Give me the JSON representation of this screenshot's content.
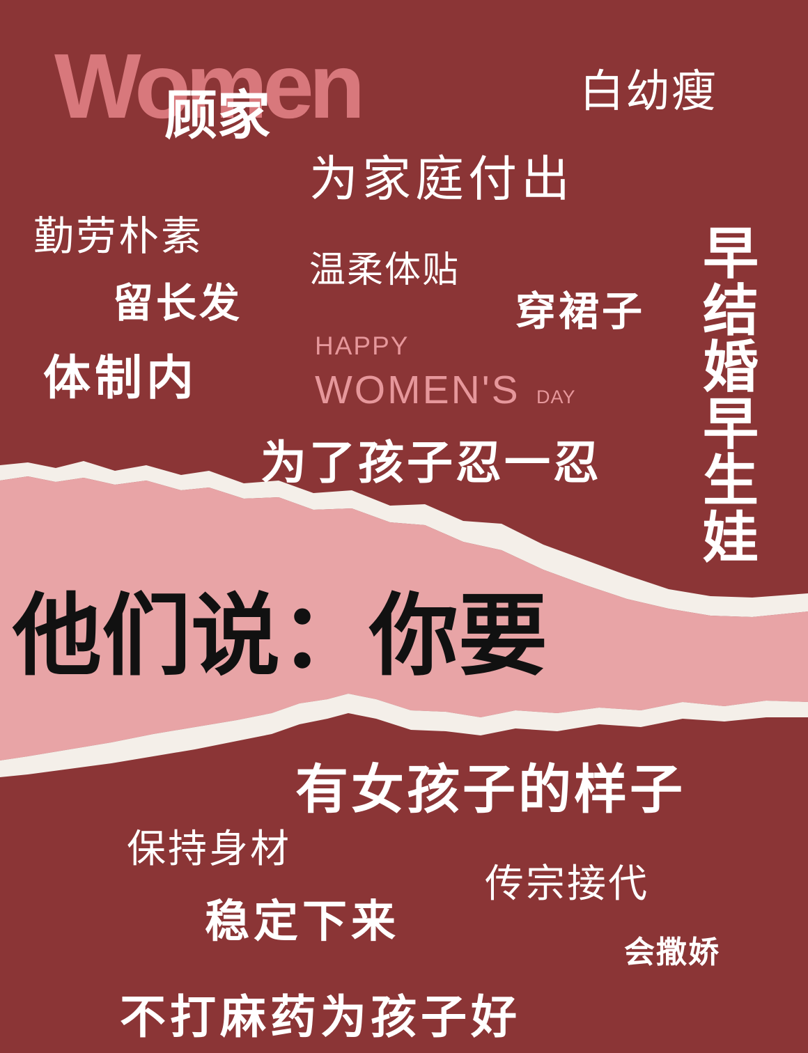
{
  "colors": {
    "background": "#8b3536",
    "tear_band": "#e8a4a6",
    "paper_edge": "#f4efe9",
    "accent_pink": "#e6979b",
    "women_watermark": "#d8787c",
    "headline_text": "#111111",
    "word_text": "#ffffff"
  },
  "watermark": {
    "women": "Women"
  },
  "badge": {
    "happy": "HAPPY",
    "womens": "WOMEN'S",
    "day": "DAY"
  },
  "words": {
    "gujia": "顾家",
    "baiyoudu": "白幼瘦",
    "weijiating": "为家庭付出",
    "qinlao": "勤劳朴素",
    "wenrou": "温柔体贴",
    "liuchangfa": "留长发",
    "chuanqunzi": "穿裙子",
    "tizhinei": "体制内",
    "zaojiehun": "早结婚早生娃",
    "renyiren": "为了孩子忍一忍",
    "nvhai": "有女孩子的样子",
    "baochi": "保持身材",
    "chuanzong": "传宗接代",
    "wending": "稳定下来",
    "sajiao": "会撒娇",
    "budama": "不打麻药为孩子好"
  },
  "headline": "他们说：你要"
}
